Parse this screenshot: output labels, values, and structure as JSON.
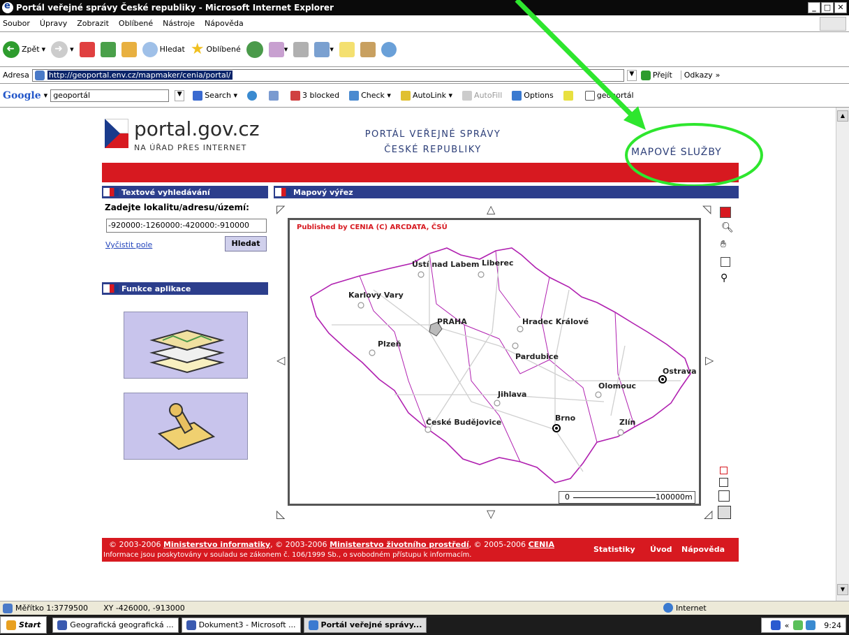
{
  "window": {
    "title": "Portál veřejné správy České republiky - Microsoft Internet Explorer"
  },
  "menu": [
    "Soubor",
    "Úpravy",
    "Zobrazit",
    "Oblíbené",
    "Nástroje",
    "Nápověda"
  ],
  "toolbar": {
    "back": "Zpět",
    "search": "Hledat",
    "favorites": "Oblíbené"
  },
  "address": {
    "label": "Adresa",
    "url": "http://geoportal.env.cz/mapmaker/cenia/portal/",
    "go": "Přejít",
    "links": "Odkazy"
  },
  "google": {
    "logo": "Google",
    "query": "geoportál",
    "search": "Search",
    "blocked": "3 blocked",
    "check": "Check",
    "autolink": "AutoLink",
    "autofill": "AutoFill",
    "options": "Options",
    "term": "geoportál"
  },
  "page": {
    "logo_title": "portal.gov.cz",
    "logo_sub": "NA ÚŘAD PŘES INTERNET",
    "portal_line1": "PORTÁL VEŘEJNÉ SPRÁVY",
    "portal_line2": "ČESKÉ REPUBLIKY",
    "map_services": "MAPOVÉ SLUŽBY",
    "text_search_head": "Textové vyhledávání",
    "search_label": "Zadejte lokalitu/adresu/území:",
    "search_value": "-920000:-1260000:-420000:-910000",
    "clear": "Vyčistit pole",
    "search_btn": "Hledat",
    "functions_head": "Funkce aplikace",
    "map_head": "Mapový výřez",
    "map_credit": "Published by CENIA    (C) ARCDATA, ČSÚ",
    "scale_zero": "0",
    "scale_max": "100000m",
    "cities": [
      "Ústí nad Labem",
      "Liberec",
      "Karlovy Vary",
      "PRAHA",
      "Hradec Králové",
      "Plzeň",
      "Pardubice",
      "Ostrava",
      "Olomouc",
      "Jihlava",
      "České Budějovice",
      "Brno",
      "Zlín"
    ]
  },
  "footer": {
    "y1": "© 2003-2006",
    "l1": "Ministerstvo informatiky",
    "y2": ", © 2003-2006",
    "l2": "Ministerstvo životního prostředí",
    "y3": ", © 2005-2006",
    "l3": "CENIA",
    "law": "Informace jsou poskytovány v souladu se zákonem č. 106/1999 Sb., o svobodném přístupu k informacím.",
    "stats": "Statistiky",
    "intro": "Úvod",
    "help": "Nápověda"
  },
  "status": {
    "scale": "Měřítko 1:3779500",
    "xy": "XY -426000, -913000",
    "zone": "Internet"
  },
  "taskbar": {
    "start": "Start",
    "t1": "Geografická geografická ...",
    "t2": "Dokument3 - Microsoft ...",
    "t3": "Portál veřejné správy...",
    "time": "9:24"
  },
  "colors": {
    "brand_red": "#d71920",
    "panel_blue": "#2c3e8c",
    "border_purple": "#b020b0"
  }
}
